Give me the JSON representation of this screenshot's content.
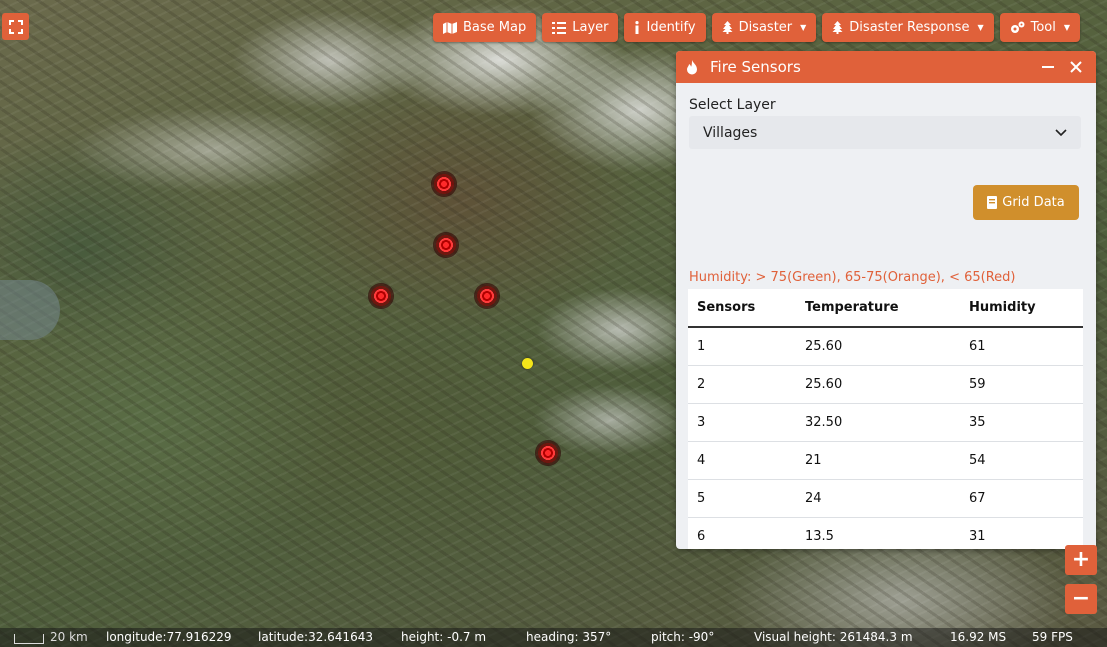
{
  "toolbar": {
    "items": [
      {
        "label": "Base Map",
        "icon": "map-icon",
        "dropdown": false
      },
      {
        "label": "Layer",
        "icon": "list-icon",
        "dropdown": false
      },
      {
        "label": "Identify",
        "icon": "info-icon",
        "dropdown": false
      },
      {
        "label": "Disaster",
        "icon": "tree-icon",
        "dropdown": true
      },
      {
        "label": "Disaster Response",
        "icon": "tree-icon",
        "dropdown": true
      },
      {
        "label": "Tool",
        "icon": "gears-icon",
        "dropdown": true
      }
    ]
  },
  "panel": {
    "title": "Fire Sensors",
    "select_label": "Select Layer",
    "select_value": "Villages",
    "grid_button": "Grid Data",
    "humidity_note": "Humidity: > 75(Green), 65-75(Orange), < 65(Red)",
    "table": {
      "headers": [
        "Sensors",
        "Temperature",
        "Humidity"
      ],
      "rows": [
        [
          "1",
          "25.60",
          "61"
        ],
        [
          "2",
          "25.60",
          "59"
        ],
        [
          "3",
          "32.50",
          "35"
        ],
        [
          "4",
          "21",
          "54"
        ],
        [
          "5",
          "24",
          "67"
        ],
        [
          "6",
          "13.5",
          "31"
        ]
      ]
    }
  },
  "zoom": {
    "in": "+",
    "out": "−"
  },
  "status": {
    "scale": "20 km",
    "longitude": "longitude:77.916229",
    "latitude": "latitude:32.641643",
    "height": "height: -0.7 m",
    "heading": "heading: 357°",
    "pitch": "pitch: -90°",
    "visual_height": "Visual height: 261484.3 m",
    "ms": "16.92 MS",
    "fps": "59 FPS"
  },
  "colors": {
    "accent": "#e0613a",
    "grid_button": "#d08f2c",
    "marker": "#ff2a2a",
    "yellow_point": "#f3e51a"
  }
}
